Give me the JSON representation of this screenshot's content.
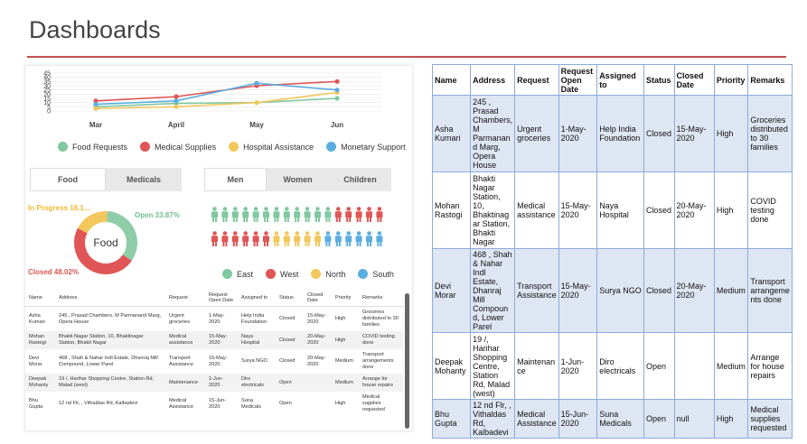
{
  "page": {
    "title": "Dashboards"
  },
  "line_chart": {
    "chart_data": {
      "type": "line",
      "categories": [
        "Mar",
        "April",
        "May",
        "Jun"
      ],
      "y_ticks": [
        "45",
        "40",
        "35",
        "30",
        "25",
        "20",
        "15",
        "10",
        "5",
        "0"
      ],
      "ylim": [
        0,
        45
      ],
      "series": [
        {
          "name": "Food Requests",
          "color": "#7fc8a0",
          "values": [
            5,
            9,
            10,
            15
          ]
        },
        {
          "name": "Medical Supplies",
          "color": "#e05555",
          "values": [
            12,
            17,
            30,
            35
          ]
        },
        {
          "name": "Hospital Assistance",
          "color": "#f2c75c",
          "values": [
            3,
            5,
            10,
            22
          ]
        },
        {
          "name": "Monetary Support",
          "color": "#5aaee0",
          "values": [
            8,
            12,
            33,
            25
          ]
        }
      ]
    }
  },
  "tabs1": [
    "Food",
    "Medicals"
  ],
  "tabs2": [
    "Men",
    "Women",
    "Children"
  ],
  "donut": {
    "center": "Food",
    "in_progress": "In Progress 18.1…",
    "open": "Open 33.87%",
    "closed": "Closed 48.02%",
    "chart_data": {
      "type": "pie",
      "slices": [
        {
          "label": "Open",
          "value": 33.87,
          "color": "#8fcca8"
        },
        {
          "label": "Closed",
          "value": 48.02,
          "color": "#e05555"
        },
        {
          "label": "In Progress",
          "value": 18.11,
          "color": "#f2c75c"
        }
      ]
    }
  },
  "people": {
    "row1": [
      "#7fc8a0",
      "#7fc8a0",
      "#7fc8a0",
      "#7fc8a0",
      "#7fc8a0",
      "#7fc8a0",
      "#7fc8a0",
      "#7fc8a0",
      "#7fc8a0",
      "#7fc8a0",
      "#7fc8a0",
      "#7fc8a0",
      "#e05555",
      "#e05555",
      "#e05555",
      "#e05555",
      "#e05555"
    ],
    "row2": [
      "#e05555",
      "#e05555",
      "#e05555",
      "#e05555",
      "#e05555",
      "#e05555",
      "#f2c75c",
      "#f2c75c",
      "#f2c75c",
      "#f2c75c",
      "#f2c75c",
      "#5aaee0",
      "#5aaee0",
      "#5aaee0",
      "#5aaee0",
      "#5aaee0",
      "#5aaee0"
    ]
  },
  "region_legend": [
    {
      "label": "East",
      "color": "#7fc8a0"
    },
    {
      "label": "West",
      "color": "#e05555"
    },
    {
      "label": "North",
      "color": "#f2c75c"
    },
    {
      "label": "South",
      "color": "#5aaee0"
    }
  ],
  "small_table": {
    "headers": [
      "Name",
      "Address",
      "Request",
      "Request Open Date",
      "Assigned to",
      "Status",
      "Closed Date",
      "Priority",
      "Remarks"
    ],
    "rows": [
      [
        "Asha Kumari",
        "245 , Prasad Chambers, M Parmanand Marg, Opera House",
        "Urgent groceries",
        "1-May-2020",
        "Help India Foundation",
        "Closed",
        "15-May-2020",
        "High",
        "Groceries distributed to 30 families"
      ],
      [
        "Mohan Rastogi",
        "Bhakti Nagar Station, 10, Bhaktinagar Station, Bhakti Nagar",
        "Medical assistance",
        "15-May-2020",
        "Naya Hospital",
        "Closed",
        "20-May-2020",
        "High",
        "COVID testing done"
      ],
      [
        "Devi Morar",
        "468 , Shah & Nahar Indl Estate, Dhanraj Mill Compound, Lower Parel",
        "Transport Assistance",
        "15-May-2020",
        "Surya NGO",
        "Closed",
        "20-May-2020",
        "Medium",
        "Transport arrangements done"
      ],
      [
        "Deepak Mohanty",
        "19 /, Harihar Shopping Centre, Station Rd, Malad (west)",
        "Maintenance",
        "1-Jun-2020",
        "Diro electricals",
        "Open",
        "",
        "Medium",
        "Arrange for house repairs"
      ],
      [
        "Bhu Gupta",
        "12 nd Flr, , Vithaldas Rd, Kalbadevi",
        "Medical Assistance",
        "15-Jun-2020",
        "Suna Medicals",
        "Open",
        "",
        "High",
        "Medical supplies requested"
      ]
    ]
  },
  "big_table": {
    "headers": [
      "Name",
      "Address",
      "Request",
      "Request Open Date",
      "Assigned to",
      "Status",
      "Closed Date",
      "Priority",
      "Remarks"
    ],
    "rows": [
      [
        "Asha Kumari",
        "245 , Prasad Chambers, M Parmanan d Marg, Opera House",
        "Urgent groceries",
        "1-May-2020",
        "Help India Foundation",
        "Closed",
        "15-May-2020",
        "High",
        "Groceries distributed to 30 families"
      ],
      [
        "Mohan Rastogi",
        "Bhakti Nagar Station, 10, Bhaktinag ar Station, Bhakti Nagar",
        "Medical assistance",
        "15-May-2020",
        "Naya Hospital",
        "Closed",
        "20-May-2020",
        "High",
        "COVID testing done"
      ],
      [
        "Devi Morar",
        "468 , Shah & Nahar Indl Estate, Dhanraj Mill Compoun d, Lower Parel",
        "Transport Assistance",
        "15-May-2020",
        "Surya NGO",
        "Closed",
        "20-May-2020",
        "Medium",
        "Transport arrangeme nts done"
      ],
      [
        "Deepak Mohanty",
        "19 /, Harihar Shopping Centre, Station Rd, Malad (west)",
        "Maintenan ce",
        "1-Jun-2020",
        "Diro electricals",
        "Open",
        "",
        "Medium",
        "Arrange for house repairs"
      ],
      [
        "Bhu Gupta",
        "12 nd Flr, , Vithaldas Rd, Kalbadevi",
        "Medical Assistance",
        "15-Jun-2020",
        "Suna Medicals",
        "Open",
        "null",
        "High",
        "Medical supplies requested"
      ]
    ]
  }
}
